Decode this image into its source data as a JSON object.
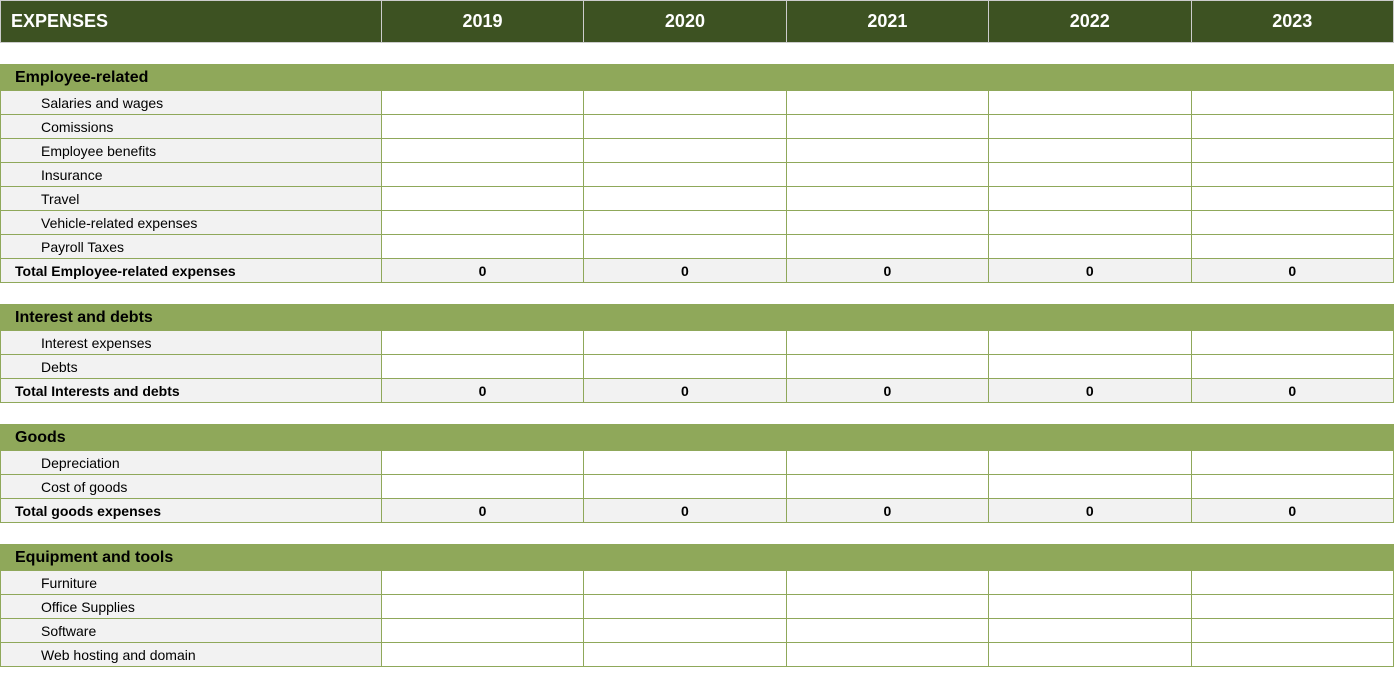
{
  "header": {
    "title": "EXPENSES",
    "years": [
      "2019",
      "2020",
      "2021",
      "2022",
      "2023"
    ]
  },
  "sections": [
    {
      "title": "Employee-related",
      "items": [
        "Salaries and wages",
        "Comissions",
        "Employee benefits",
        "Insurance",
        "Travel",
        "Vehicle-related expenses",
        "Payroll Taxes"
      ],
      "total_label": "Total Employee-related expenses",
      "totals": [
        "0",
        "0",
        "0",
        "0",
        "0"
      ]
    },
    {
      "title": "Interest and debts",
      "items": [
        "Interest expenses",
        "Debts"
      ],
      "total_label": "Total Interests and debts",
      "totals": [
        "0",
        "0",
        "0",
        "0",
        "0"
      ]
    },
    {
      "title": "Goods",
      "items": [
        "Depreciation",
        "Cost of goods"
      ],
      "total_label": "Total goods expenses",
      "totals": [
        "0",
        "0",
        "0",
        "0",
        "0"
      ]
    },
    {
      "title": "Equipment and tools",
      "items": [
        "Furniture",
        "Office Supplies",
        "Software",
        "Web hosting and domain"
      ],
      "total_label": null,
      "totals": []
    }
  ]
}
